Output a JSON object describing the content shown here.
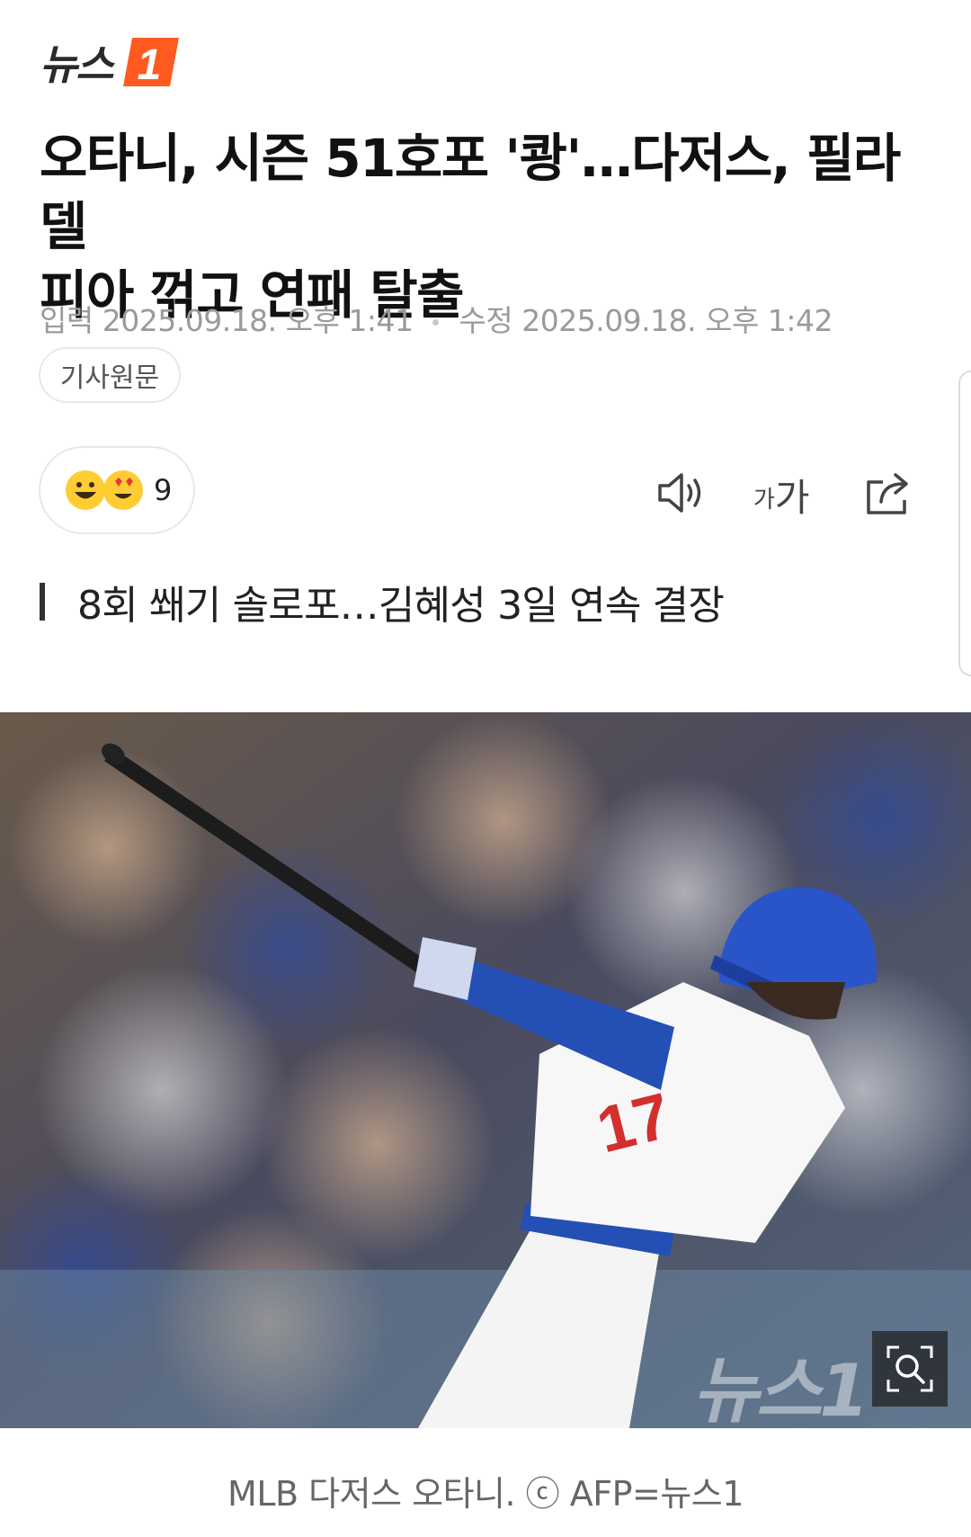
{
  "brand": {
    "logo_text": "뉴스",
    "logo_number": "1",
    "accent_color": "#ff5a1f"
  },
  "article": {
    "headline_line1": "오타니, 시즌 51호포 '쾅'…다저스, 필라델",
    "headline_line2": "피아 꺾고 연패 탈출",
    "published_label": "입력",
    "published_value": "2025.09.18. 오후 1:41",
    "modified_label": "수정",
    "modified_value": "2025.09.18. 오후 1:42",
    "original_button": "기사원문",
    "reaction_count": "9",
    "subheading": "8회 쐐기 솔로포…김혜성 3일 연속 결장"
  },
  "tools": {
    "icons": [
      "speaker-icon",
      "font-size-icon",
      "share-icon"
    ],
    "font_size_label_small": "가",
    "font_size_label_large": "가"
  },
  "photo": {
    "watermark": "뉴스1",
    "jersey_number": "17",
    "caption": "MLB 다저스 오타니. ⓒ AFP=뉴스1"
  }
}
